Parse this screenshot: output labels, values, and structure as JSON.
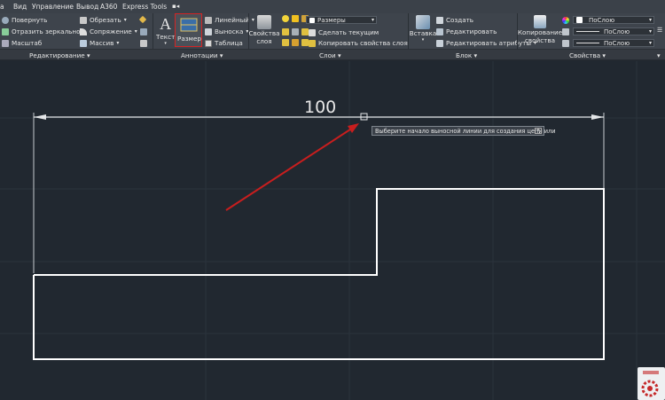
{
  "menu": {
    "tabs": [
      "а",
      "Вид",
      "Управление",
      "Вывод",
      "А360",
      "Express Tools"
    ]
  },
  "ribbon": {
    "edit": {
      "rotate": "Повернуть",
      "mirror": "Отразить зеркально",
      "scale": "Масштаб",
      "trim": "Обрезать",
      "fillet": "Сопряжение",
      "array": "Массив"
    },
    "annotations": {
      "text": "Текст",
      "dimension": "Размер",
      "linear": "Линейный",
      "leader": "Выноска",
      "table": "Таблица"
    },
    "layers": {
      "properties": "Свойства",
      "properties2": "слоя",
      "current_layer": "Размеры",
      "make_current": "Сделать текущим",
      "match_layer": "Копировать свойства слоя"
    },
    "block": {
      "insert": "Вставка",
      "create": "Создать",
      "edit": "Редактировать",
      "edit_attr": "Редактировать атрибуты"
    },
    "match_props": {
      "line1": "Копирование",
      "line2": "свойства"
    },
    "properties": {
      "color": "ПоСлою",
      "linetype": "ПоСлою",
      "lineweight": "ПоСлою"
    }
  },
  "panels": {
    "edit": "Редактирование",
    "annotations": "Аннотации",
    "layers": "Слои",
    "block": "Блок",
    "properties": "Свойства"
  },
  "drawing": {
    "dimension_value": "100",
    "tooltip": "Выберите начало выносной линии для создания цепи или"
  },
  "colors": {
    "accent_highlight": "#d42424",
    "arrow": "#c81e1e",
    "geometry": "#ffffff",
    "background": "#212830"
  }
}
